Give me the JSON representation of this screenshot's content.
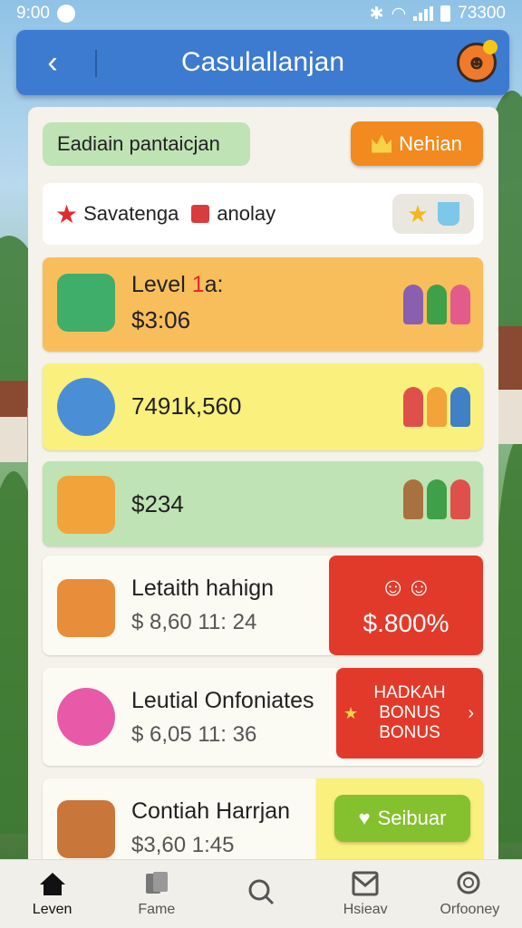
{
  "status_bar": {
    "time": "9:00",
    "right_text": "73300"
  },
  "header": {
    "title": "Casulallanjan"
  },
  "chips": {
    "left_label": "Eadiain pantaicjan",
    "right_label": "Nehian"
  },
  "search_row": {
    "text_part1": "Savatenga",
    "text_part2": "anolay"
  },
  "cards": [
    {
      "title_prefix": "Level ",
      "title_accent": "1",
      "title_suffix": "a:",
      "value": "$3:06"
    },
    {
      "value": "7491k,560"
    },
    {
      "value": "$234"
    },
    {
      "title": "Letaith hahign",
      "value": "$ 8,60 11: 24",
      "badge": "$.800%"
    },
    {
      "title": "Leutial Onfoniates",
      "value": "$ 6,05 11: 36",
      "bonus_line1": "HADKAH",
      "bonus_line2": "BONUS",
      "bonus_line3": "BONUS"
    },
    {
      "title": "Contiah Harrjan",
      "value": "$3,60 1:45",
      "button_label": "Seibuar"
    }
  ],
  "nav": [
    {
      "label": "Leven",
      "icon": "home-icon",
      "active": true
    },
    {
      "label": "Fame",
      "icon": "cards-icon",
      "active": false
    },
    {
      "label": "",
      "icon": "search-icon",
      "active": false
    },
    {
      "label": "Hsieav",
      "icon": "inbox-icon",
      "active": false
    },
    {
      "label": "Orfooney",
      "icon": "search-icon",
      "active": false
    }
  ],
  "colors": {
    "header": "#3d7bd0",
    "orange": "#f28a1f",
    "red": "#e23a2a",
    "green_btn": "#85c12e"
  }
}
